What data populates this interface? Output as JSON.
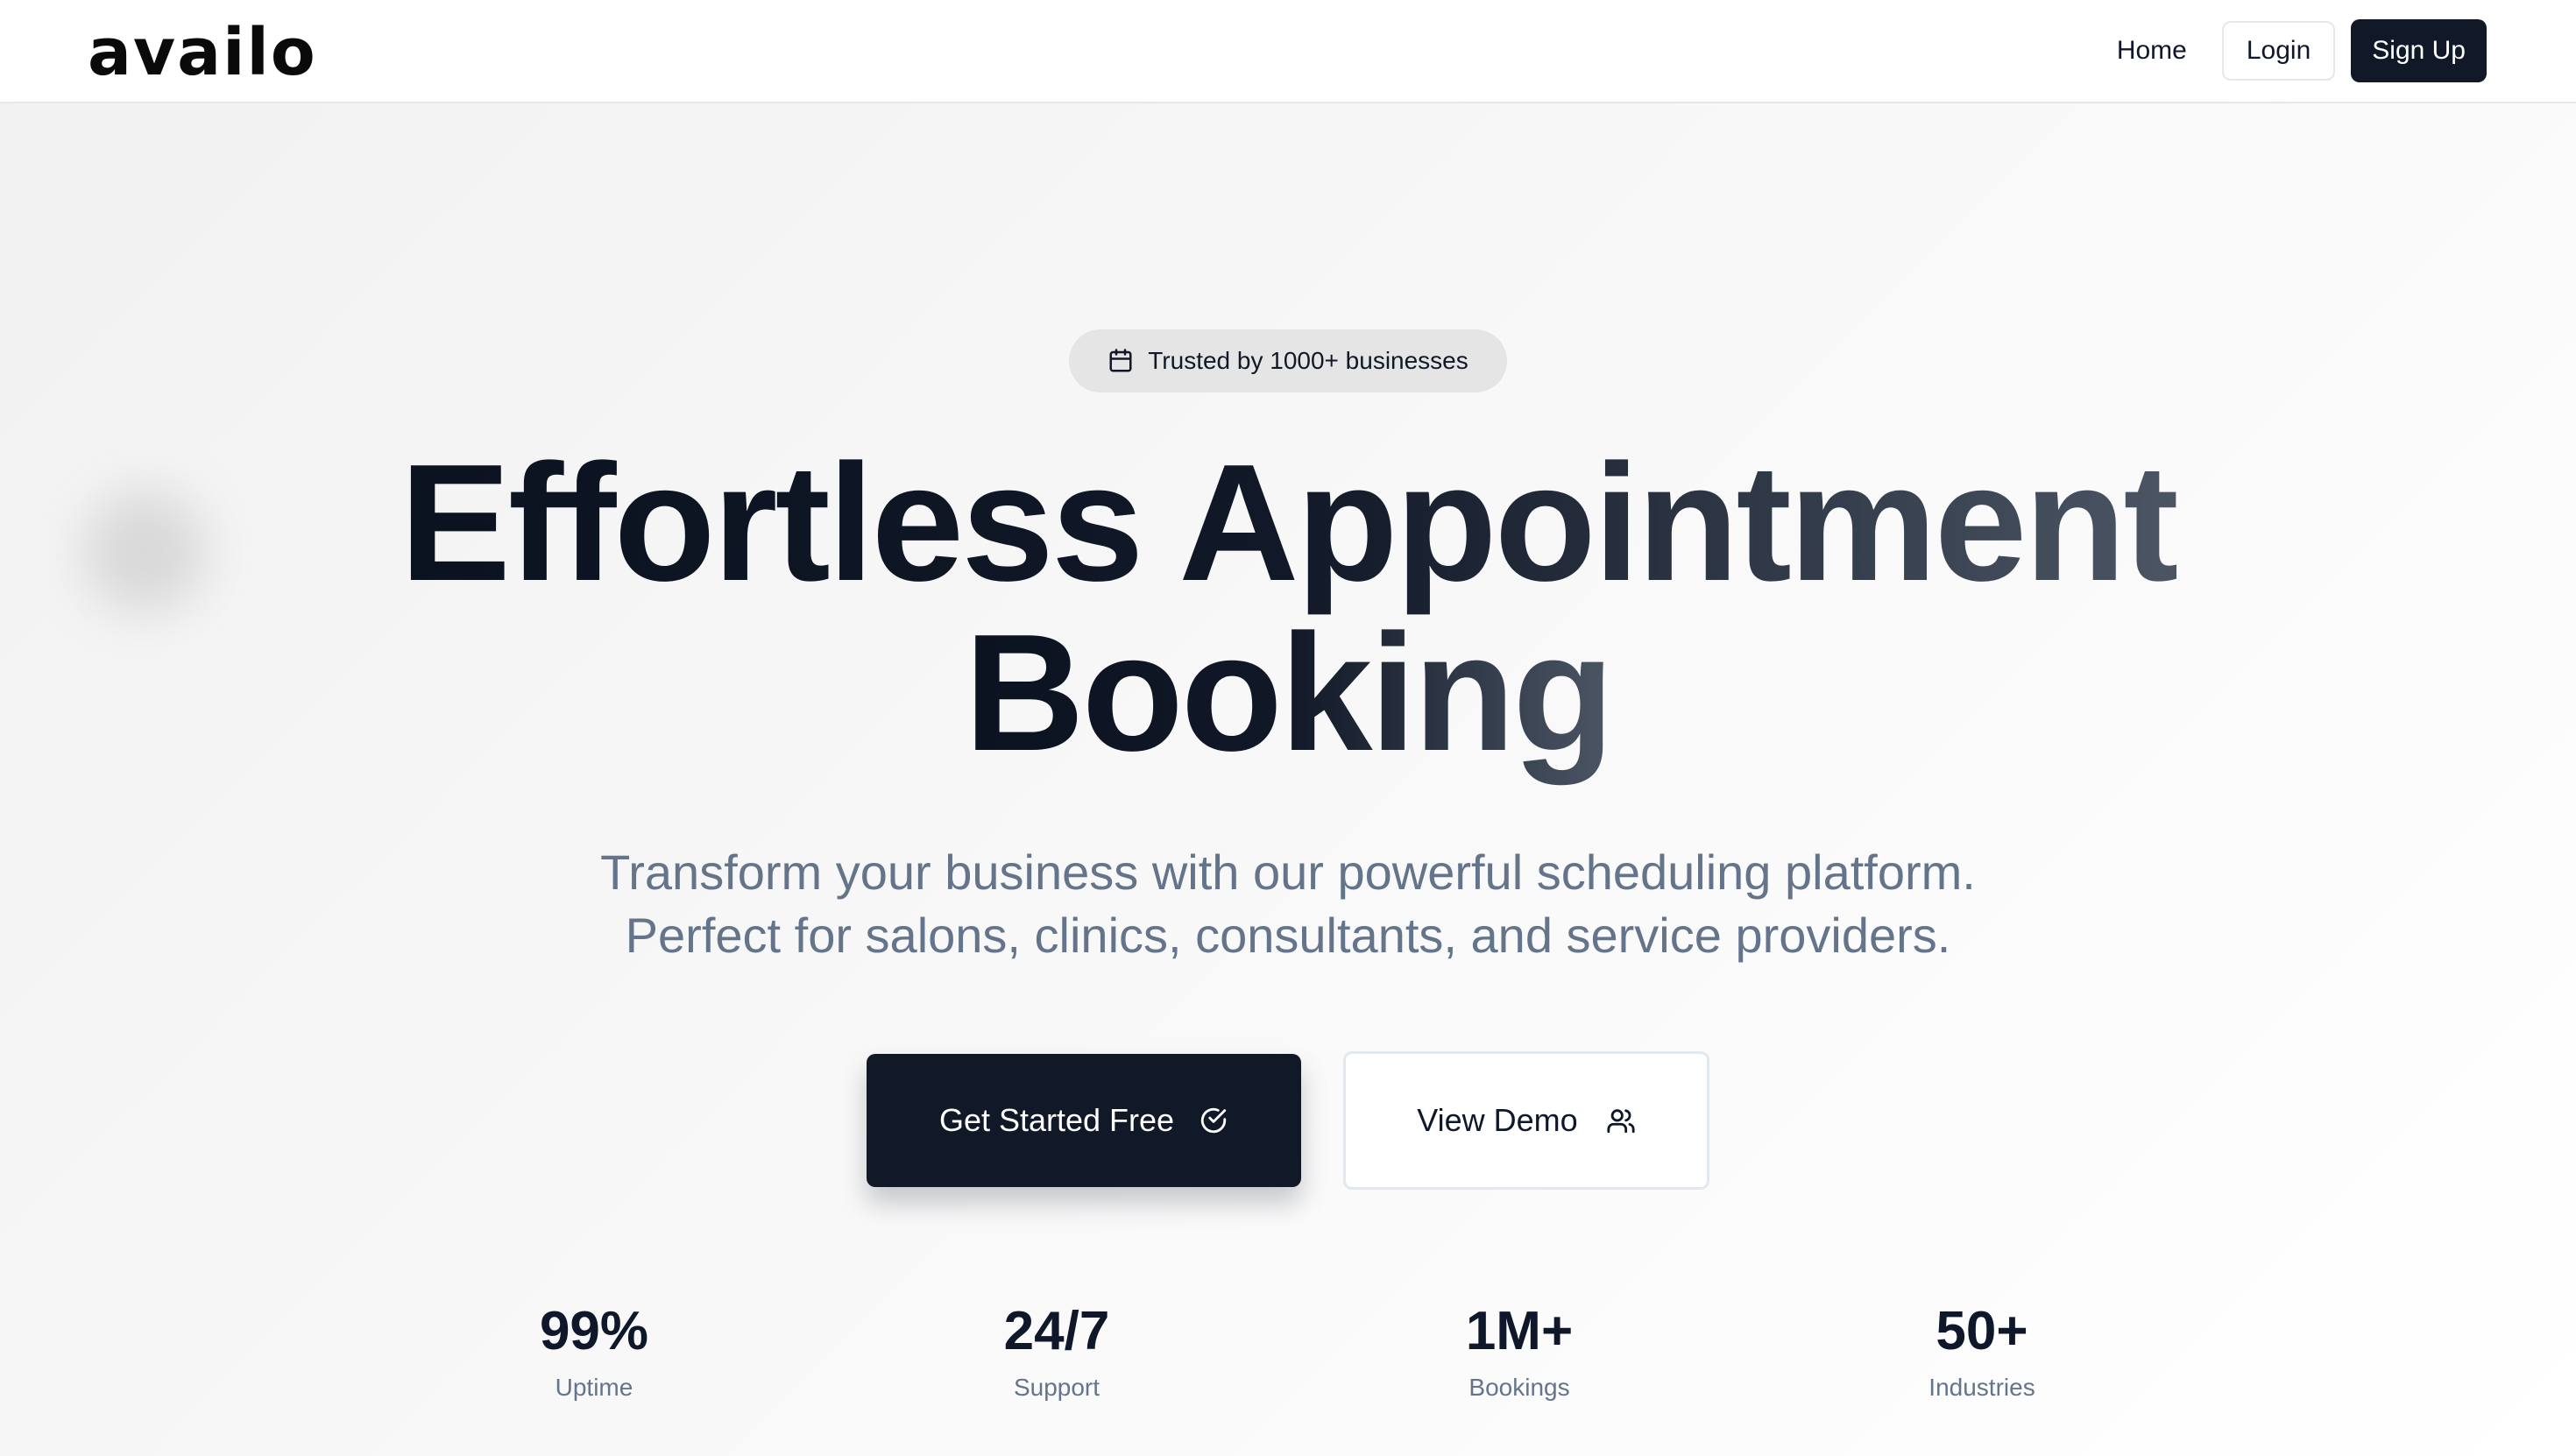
{
  "header": {
    "logo": "availo",
    "nav": {
      "home": "Home",
      "login": "Login",
      "signup": "Sign Up"
    }
  },
  "hero": {
    "badge": {
      "icon": "calendar-icon",
      "text": "Trusted by 1000+ businesses"
    },
    "headline_line1": "Effortless Appointment",
    "headline_line2": "Booking",
    "subtitle_line1": "Transform your business with our powerful scheduling platform.",
    "subtitle_line2": "Perfect for salons, clinics, consultants, and service providers.",
    "primary_cta": {
      "label": "Get Started Free",
      "icon": "check-circle-icon"
    },
    "secondary_cta": {
      "label": "View Demo",
      "icon": "users-icon"
    }
  },
  "stats": [
    {
      "value": "99%",
      "label": "Uptime"
    },
    {
      "value": "24/7",
      "label": "Support"
    },
    {
      "value": "1M+",
      "label": "Bookings"
    },
    {
      "value": "50+",
      "label": "Industries"
    }
  ],
  "colors": {
    "primary": "#111827",
    "muted_text": "#64748b",
    "badge_bg": "#e5e5e5"
  }
}
